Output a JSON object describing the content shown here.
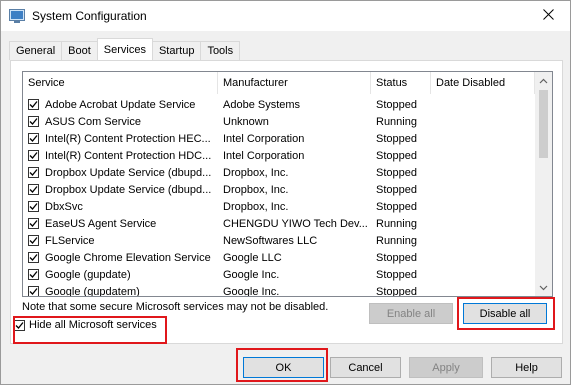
{
  "window": {
    "title": "System Configuration",
    "app_icon": "msconfig-icon",
    "close_icon": "close-icon"
  },
  "tabs": [
    {
      "label": "General",
      "active": false
    },
    {
      "label": "Boot",
      "active": false
    },
    {
      "label": "Services",
      "active": true
    },
    {
      "label": "Startup",
      "active": false
    },
    {
      "label": "Tools",
      "active": false
    }
  ],
  "services_list": {
    "columns": [
      "Service",
      "Manufacturer",
      "Status",
      "Date Disabled"
    ],
    "rows": [
      {
        "service": "Adobe Acrobat Update Service",
        "manufacturer": "Adobe Systems",
        "status": "Stopped",
        "date_disabled": "",
        "checked": true
      },
      {
        "service": "ASUS Com Service",
        "manufacturer": "Unknown",
        "status": "Running",
        "date_disabled": "",
        "checked": true
      },
      {
        "service": "Intel(R) Content Protection HEC...",
        "manufacturer": "Intel Corporation",
        "status": "Stopped",
        "date_disabled": "",
        "checked": true
      },
      {
        "service": "Intel(R) Content Protection HDC...",
        "manufacturer": "Intel Corporation",
        "status": "Stopped",
        "date_disabled": "",
        "checked": true
      },
      {
        "service": "Dropbox Update Service (dbupd...",
        "manufacturer": "Dropbox, Inc.",
        "status": "Stopped",
        "date_disabled": "",
        "checked": true
      },
      {
        "service": "Dropbox Update Service (dbupd...",
        "manufacturer": "Dropbox, Inc.",
        "status": "Stopped",
        "date_disabled": "",
        "checked": true
      },
      {
        "service": "DbxSvc",
        "manufacturer": "Dropbox, Inc.",
        "status": "Stopped",
        "date_disabled": "",
        "checked": true
      },
      {
        "service": "EaseUS Agent Service",
        "manufacturer": "CHENGDU YIWO Tech Dev...",
        "status": "Running",
        "date_disabled": "",
        "checked": true
      },
      {
        "service": "FLService",
        "manufacturer": "NewSoftwares LLC",
        "status": "Running",
        "date_disabled": "",
        "checked": true
      },
      {
        "service": "Google Chrome Elevation Service",
        "manufacturer": "Google LLC",
        "status": "Stopped",
        "date_disabled": "",
        "checked": true
      },
      {
        "service": "Google (gupdate)",
        "manufacturer": "Google Inc.",
        "status": "Stopped",
        "date_disabled": "",
        "checked": true
      },
      {
        "service": "Google (gupdatem)",
        "manufacturer": "Google Inc.",
        "status": "Stopped",
        "date_disabled": "",
        "checked": true
      }
    ]
  },
  "note": "Note that some secure Microsoft services may not be disabled.",
  "buttons": {
    "enable_all": "Enable all",
    "disable_all": "Disable all",
    "ok": "OK",
    "cancel": "Cancel",
    "apply": "Apply",
    "help": "Help"
  },
  "hide_ms": {
    "label": "Hide all Microsoft services",
    "checked": true
  },
  "colors": {
    "highlight_box": "#e0171b",
    "default_button_border": "#0078d7"
  }
}
